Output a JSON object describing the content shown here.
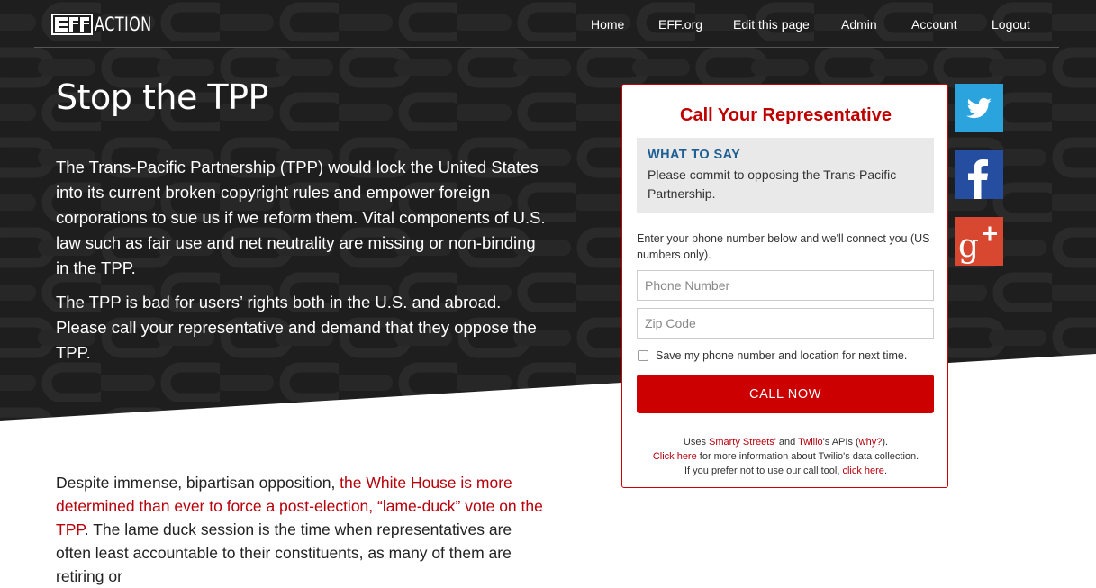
{
  "header": {
    "logo_text": "ACTION",
    "nav": [
      "Home",
      "EFF.org",
      "Edit this page",
      "Admin",
      "Account",
      "Logout"
    ]
  },
  "hero": {
    "title": "Stop the TPP",
    "paragraph1": "The Trans-Pacific Partnership (TPP) would lock the United States into its current broken copyright rules and empower foreign corporations to sue us if we reform them. Vital components of U.S. law such as fair use and net neutrality are missing or non-binding in the TPP.",
    "paragraph2": "The TPP is bad for users’ rights both in the U.S. and abroad. Please call your representative and demand that they oppose the TPP."
  },
  "body": {
    "lead": "Despite immense, bipartisan opposition, ",
    "link": "the White House is more determined than ever to force a post-election, “lame-duck” vote on the TPP",
    "rest": ". The lame duck session is the time when representatives are often least accountable to their constituents, as many of them are retiring or"
  },
  "call_tool": {
    "title": "Call Your Representative",
    "what_to_say_heading": "WHAT TO SAY",
    "what_to_say_text": "Please commit to opposing the Trans-Pacific Partnership.",
    "instructions": "Enter your phone number below and we'll connect you (US numbers only).",
    "phone_placeholder": "Phone Number",
    "zip_placeholder": "Zip Code",
    "save_label": "Save my phone number and location for next time.",
    "save_checked": false,
    "button_label": "CALL NOW",
    "fine_print": {
      "uses": "Uses ",
      "smarty": "Smarty Streets'",
      "and": " and ",
      "twilio": "Twilio",
      "apis": "'s APIs (",
      "why": "why?",
      "close": ").",
      "click_here": "Click here",
      "info": " for more information about Twilio's data collection.",
      "prefer": "If you prefer not to use our call tool, ",
      "click_here2": "click here",
      "period": "."
    }
  },
  "social": {
    "icons": [
      "twitter-icon",
      "facebook-icon",
      "google-plus-icon"
    ]
  },
  "colors": {
    "accent_red": "#cc0000",
    "hero_dark": "#1c1c1c",
    "twitter_blue": "#2ba4dd",
    "facebook_blue": "#254ea0",
    "gplus_red": "#d8472f",
    "what_to_say_blue": "#1d5f95"
  }
}
